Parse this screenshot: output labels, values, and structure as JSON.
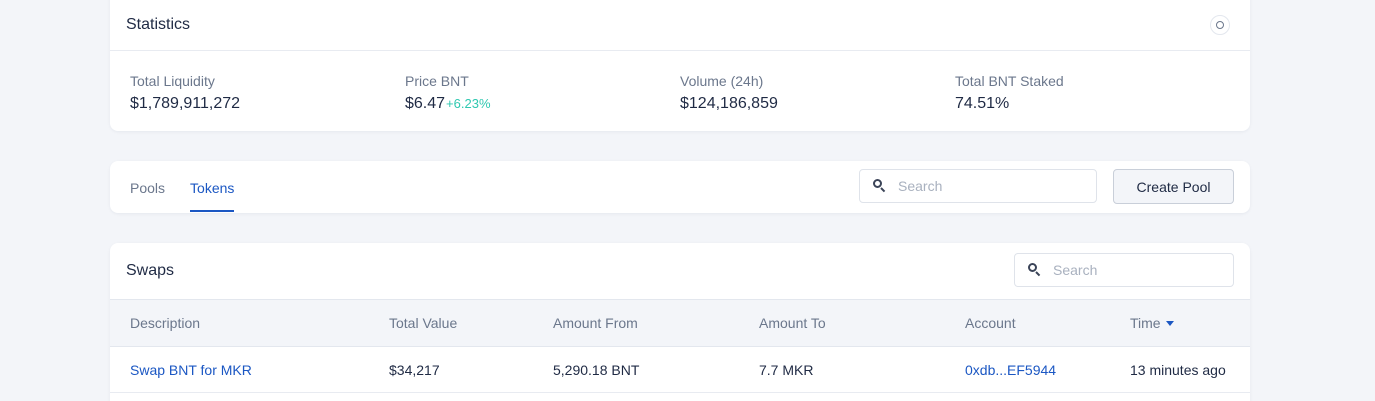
{
  "statistics": {
    "title": "Statistics",
    "items": [
      {
        "label": "Total Liquidity",
        "value": "$1,789,911,272"
      },
      {
        "label": "Price BNT",
        "value": "$6.47",
        "change": "+6.23%"
      },
      {
        "label": "Volume (24h)",
        "value": "$124,186,859"
      },
      {
        "label": "Total BNT Staked",
        "value": "74.51%"
      }
    ]
  },
  "tabs": {
    "items": [
      {
        "label": "Pools",
        "active": false
      },
      {
        "label": "Tokens",
        "active": true
      }
    ],
    "search_placeholder": "Search",
    "create_pool_label": "Create Pool"
  },
  "swaps": {
    "title": "Swaps",
    "search_placeholder": "Search",
    "columns": [
      "Description",
      "Total Value",
      "Amount From",
      "Amount To",
      "Account",
      "Time"
    ],
    "sort_column": "Time",
    "rows": [
      {
        "description": "Swap BNT for MKR",
        "total_value": "$34,217",
        "amount_from": "5,290.18 BNT",
        "amount_to": "7.7 MKR",
        "account": "0xdb...EF5944",
        "time": "13 minutes ago"
      }
    ]
  },
  "colors": {
    "accent": "#1b57c3",
    "positive": "#2fc8b0",
    "background": "#f3f5f9"
  }
}
